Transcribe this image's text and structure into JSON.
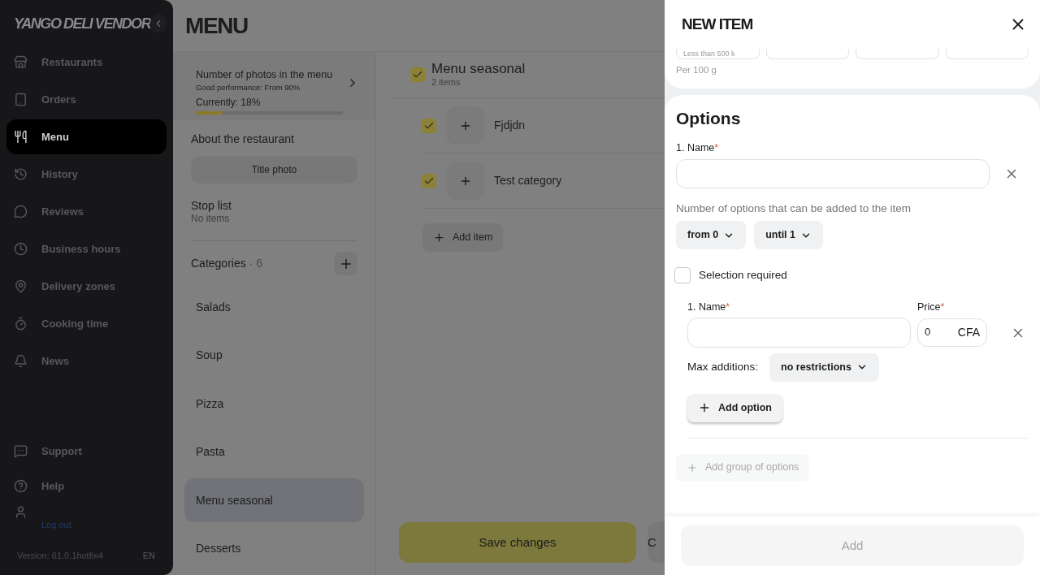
{
  "sidebar": {
    "logo": "YANGO DELI VENDOR",
    "nav": [
      {
        "label": "Restaurants",
        "selected": false
      },
      {
        "label": "Orders",
        "selected": false
      },
      {
        "label": "Menu",
        "selected": true
      },
      {
        "label": "History",
        "selected": false
      },
      {
        "label": "Reviews",
        "selected": false
      },
      {
        "label": "Business hours",
        "selected": false
      },
      {
        "label": "Delivery zones",
        "selected": false
      },
      {
        "label": "Cooking time",
        "selected": false
      },
      {
        "label": "News",
        "selected": false
      }
    ],
    "bottom": [
      {
        "label": "Support"
      },
      {
        "label": "Help"
      }
    ],
    "logout": "Log out",
    "version": "Version: 61.0.1hotfix4",
    "language": "EN"
  },
  "page": {
    "title": "MENU"
  },
  "photos_card": {
    "title": "Number of photos in the menu",
    "subtitle": "Good performance: From 90%",
    "current": "Currently: 18%",
    "level": 0.18
  },
  "about": {
    "title": "About the restaurant",
    "button": "Title photo"
  },
  "stop_list": {
    "title": "Stop list",
    "subtitle": "No items"
  },
  "categories": {
    "title": "Categories",
    "separator": "·",
    "count": "6",
    "items": [
      {
        "label": "Salads",
        "selected": false
      },
      {
        "label": "Soup",
        "selected": false
      },
      {
        "label": "Pizza",
        "selected": false
      },
      {
        "label": "Pasta",
        "selected": false
      },
      {
        "label": "Menu seasonal",
        "selected": true
      },
      {
        "label": "Desserts",
        "selected": false
      }
    ]
  },
  "category_detail": {
    "title": "Menu seasonal",
    "subtitle": "2 items",
    "checked": true,
    "items": [
      {
        "name": "Fjdjdn",
        "checked": true
      },
      {
        "name": "Test category",
        "checked": true
      }
    ],
    "add_button": "Add item"
  },
  "actions": {
    "save": "Save changes",
    "cancel": "C"
  },
  "drawer": {
    "title": "NEW ITEM",
    "nutrition": {
      "first_placeholder": "Less than 500 k",
      "note": "Per 100 g"
    },
    "options": {
      "title": "Options",
      "name_label": "1. Name",
      "required_mark": "*",
      "count_label": "Number of options that can be added to the item",
      "from": "from 0",
      "until": "until 1",
      "selection_required": {
        "label": "Selection required",
        "checked": false
      },
      "option": {
        "name_label": "1. Name",
        "price_label": "Price",
        "required_mark": "*",
        "price_value": "0",
        "currency": "CFA",
        "max_label": "Max additions:",
        "max_value": "no restrictions"
      },
      "add_option": "Add option",
      "add_group": {
        "label": "Add group of options",
        "disabled": true
      }
    },
    "submit": {
      "label": "Add",
      "disabled": true
    }
  }
}
